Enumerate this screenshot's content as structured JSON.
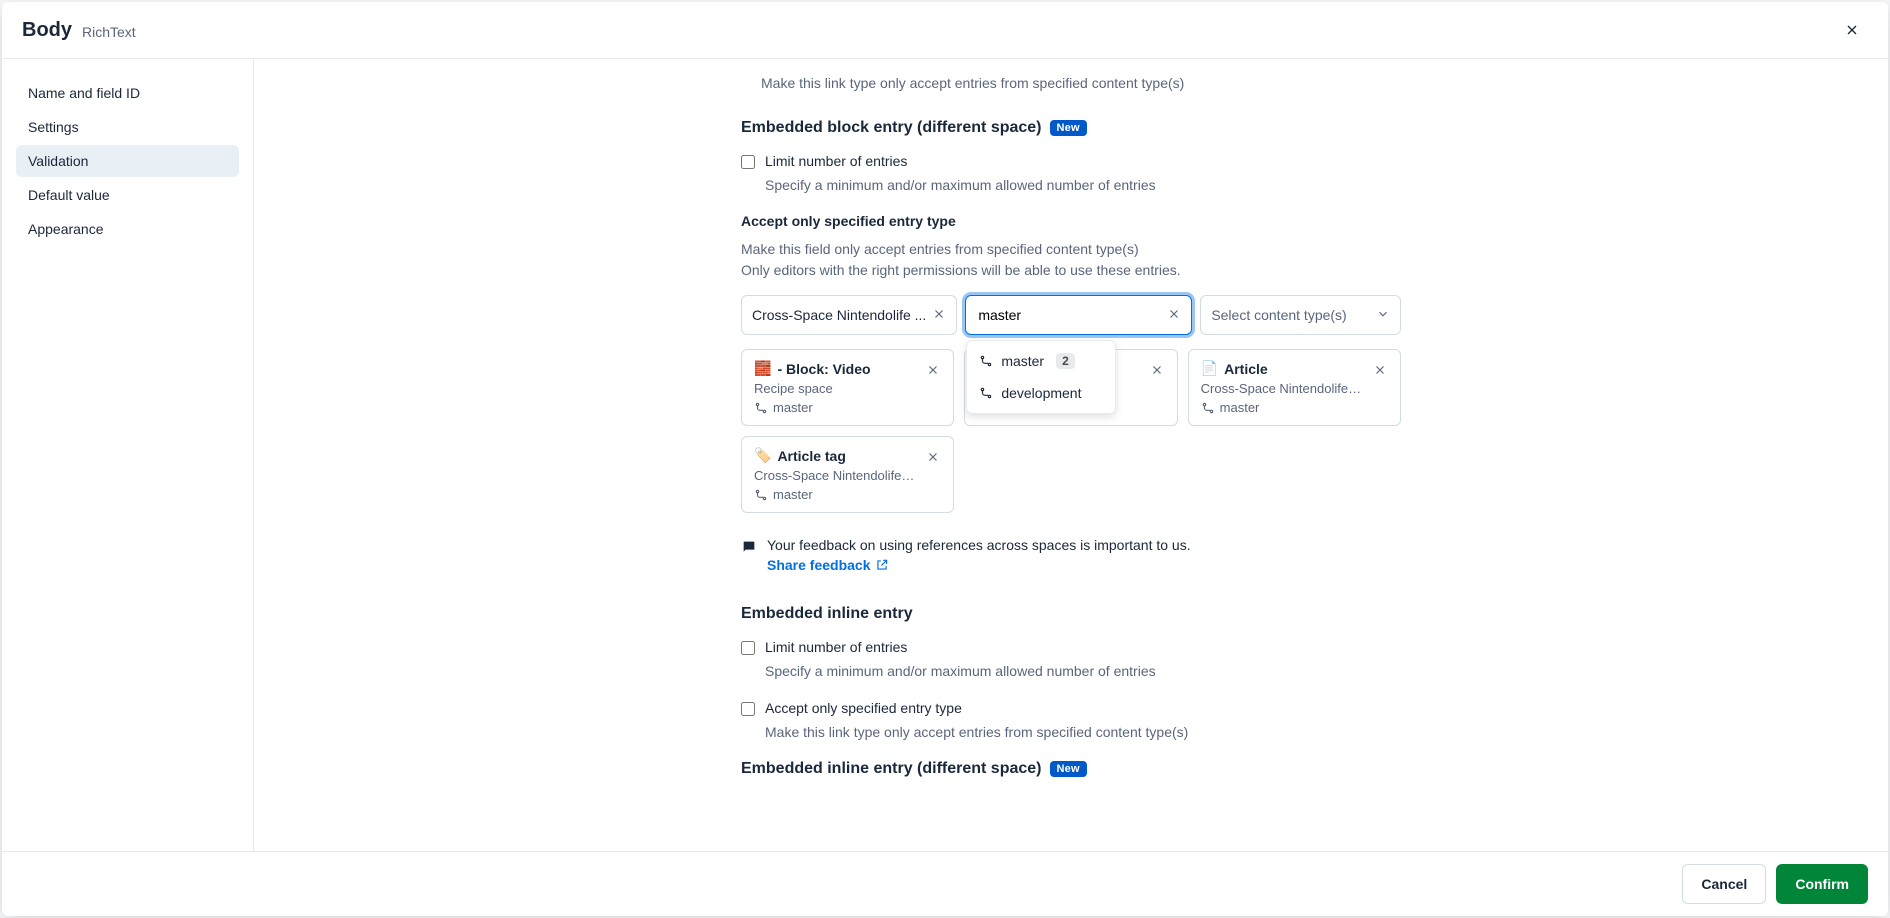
{
  "header": {
    "title": "Body",
    "subtitle": "RichText"
  },
  "sidebar": {
    "items": [
      {
        "label": "Name and field ID"
      },
      {
        "label": "Settings"
      },
      {
        "label": "Validation"
      },
      {
        "label": "Default value"
      },
      {
        "label": "Appearance"
      }
    ],
    "activeIndex": 2
  },
  "content": {
    "topCutNote": "Make this link type only accept entries from specified content type(s)",
    "embeddedBlock": {
      "heading": "Embedded block entry (different space)",
      "badge": "New",
      "limitEntries": {
        "label": "Limit number of entries",
        "help": "Specify a minimum and/or maximum allowed number of entries",
        "checked": false
      },
      "acceptType": {
        "heading": "Accept only specified entry type",
        "desc1": "Make this field only accept entries from specified content type(s)",
        "desc2": "Only editors with the right permissions will be able to use these entries."
      },
      "selectors": {
        "space": {
          "value": "Cross-Space Nintendolife ..."
        },
        "environment": {
          "value": "master",
          "dropdown": {
            "items": [
              {
                "label": "master",
                "count": "2"
              },
              {
                "label": "development"
              }
            ]
          }
        },
        "contentType": {
          "placeholder": "Select content type(s)"
        }
      },
      "chips": [
        {
          "emoji": "🧱",
          "title": "- Block: Video",
          "space": "Recipe space",
          "env": "master"
        },
        {
          "emoji": "",
          "title": "",
          "space": "",
          "env": ""
        },
        {
          "emoji": "📄",
          "title": "Article",
          "space": "Cross-Space Nintendolife - E...",
          "env": "master"
        },
        {
          "emoji": "🏷️",
          "title": "Article tag",
          "space": "Cross-Space Nintendolife - E...",
          "env": "master"
        }
      ],
      "feedback": {
        "text": "Your feedback on using references across spaces is important to us.",
        "linkLabel": "Share feedback"
      }
    },
    "embeddedInline": {
      "heading": "Embedded inline entry",
      "limitEntries": {
        "label": "Limit number of entries",
        "help": "Specify a minimum and/or maximum allowed number of entries",
        "checked": false
      },
      "acceptType": {
        "label": "Accept only specified entry type",
        "help": "Make this link type only accept entries from specified content type(s)",
        "checked": false
      }
    },
    "embeddedInlineDiff": {
      "heading": "Embedded inline entry (different space)",
      "badge": "New"
    }
  },
  "footer": {
    "cancel": "Cancel",
    "confirm": "Confirm"
  }
}
